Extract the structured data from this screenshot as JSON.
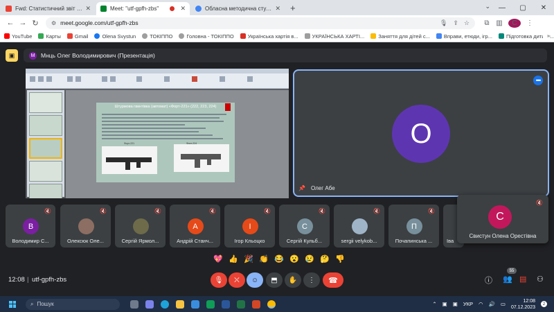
{
  "browser": {
    "tabs": [
      {
        "title": "Fwd: Статистичний звіт працівн...",
        "favicon_color": "#ea4335",
        "active": false
      },
      {
        "title": "Meet: \"utf-gpfh-zbs\"",
        "favicon_color": "#00832d",
        "active": true
      },
      {
        "title": "Обласна методична студія «В...",
        "favicon_color": "#4285f4",
        "active": false
      }
    ],
    "new_tab": "+",
    "url": "meet.google.com/utf-gpfh-zbs",
    "profile_initial": "C",
    "bookmarks": [
      {
        "label": "YouTube",
        "color": "#ff0000"
      },
      {
        "label": "Карты",
        "color": "#34a853"
      },
      {
        "label": "Gmail",
        "color": "#ea4335"
      },
      {
        "label": "Olena Svystun",
        "color": "#1877f2"
      },
      {
        "label": "ТОКІППО",
        "color": "#9e9e9e"
      },
      {
        "label": "Головна - ТОКІППО",
        "color": "#9e9e9e"
      },
      {
        "label": "Українська хартія в...",
        "color": "#d93025"
      },
      {
        "label": "УКРАЇНСЬКА ХАРТІ...",
        "color": "#9e9e9e"
      },
      {
        "label": "Заняття для дітей с...",
        "color": "#fbbc04"
      },
      {
        "label": "Вправи, етюди, ігр...",
        "color": "#4285f4"
      },
      {
        "label": "Підготовка дитини...",
        "color": "#00897b"
      }
    ],
    "bookmarks_more": "»"
  },
  "meet": {
    "presenter_banner": "Мнць Олег Володимирович (Презентація)",
    "presenter_initial": "М",
    "slide_title": "Штурмова гвинтівка (автомат) «Форт-221» (222, 223, 224)",
    "slide_caption_left": "Форт-221",
    "slide_caption_right": "Форт-224",
    "main_tile": {
      "initial": "О",
      "name": "Олег Абе",
      "color": "#5e35b1"
    },
    "participants": [
      {
        "name": "Володимир С...",
        "initial": "В",
        "color": "#7b1fa2",
        "photo": false
      },
      {
        "name": "Олексюк Оле...",
        "initial": "",
        "color": "#8d6e63",
        "photo": true
      },
      {
        "name": "Сергій Ярмол...",
        "initial": "",
        "color": "#6d6b4a",
        "photo": true
      },
      {
        "name": "Андрій Станч...",
        "initial": "А",
        "color": "#e64a19",
        "photo": false
      },
      {
        "name": "Ігор Кльоцко",
        "initial": "І",
        "color": "#e64a19",
        "photo": false
      },
      {
        "name": "Сергій Кульб...",
        "initial": "С",
        "color": "#78909c",
        "photo": false
      },
      {
        "name": "sergii velykob...",
        "initial": "",
        "color": "#9fb4c7",
        "photo": true
      },
      {
        "name": "Почапинська ...",
        "initial": "П",
        "color": "#78909c",
        "photo": false
      },
      {
        "name": "Іва",
        "initial": "",
        "color": "#3c4043",
        "photo": false
      }
    ],
    "popup": {
      "name": "Свистун Олена Орестівна",
      "initial": "С",
      "color": "#c2185b"
    },
    "reactions": [
      "💖",
      "👍",
      "🎉",
      "👏",
      "😂",
      "😮",
      "😢",
      "🤔",
      "👎"
    ],
    "clock": "12:08",
    "meeting_code": "utf-gpfh-zbs",
    "participant_count": "55"
  },
  "taskbar": {
    "search_placeholder": "Пошук",
    "lang": "УКР",
    "time": "12:08",
    "date": "07.12.2023",
    "notif_count": "2"
  }
}
